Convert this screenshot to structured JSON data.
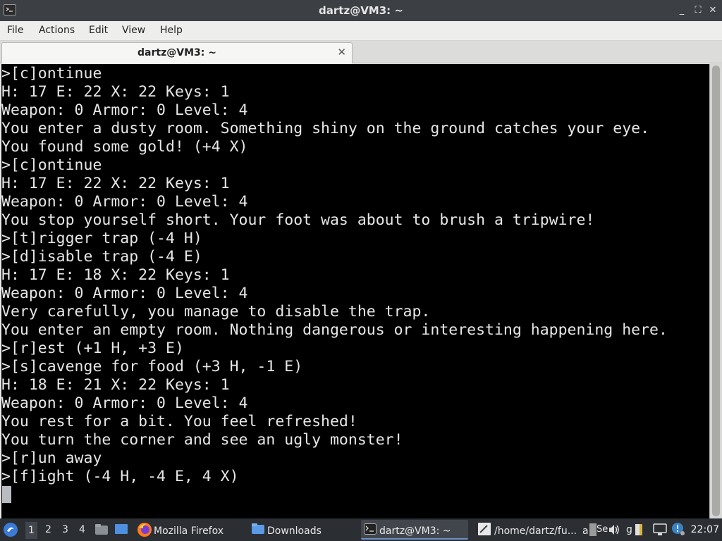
{
  "window": {
    "title": "dartz@VM3: ~",
    "controls": [
      "_",
      "⛶",
      "✕"
    ]
  },
  "menu": [
    "File",
    "Actions",
    "Edit",
    "View",
    "Help"
  ],
  "tab": {
    "label": "dartz@VM3: ~",
    "close": "✕"
  },
  "terminal": {
    "lines": [
      ">[c]ontinue",
      "H: 17 E: 22 X: 22 Keys: 1",
      "Weapon: 0 Armor: 0 Level: 4",
      "You enter a dusty room. Something shiny on the ground catches your eye.",
      "You found some gold! (+4 X)",
      ">[c]ontinue",
      "H: 17 E: 22 X: 22 Keys: 1",
      "Weapon: 0 Armor: 0 Level: 4",
      "You stop yourself short. Your foot was about to brush a tripwire!",
      ">[t]rigger trap (-4 H)",
      ">[d]isable trap (-4 E)",
      "H: 17 E: 18 X: 22 Keys: 1",
      "Weapon: 0 Armor: 0 Level: 4",
      "Very carefully, you manage to disable the trap.",
      "You enter an empty room. Nothing dangerous or interesting happening here.",
      ">[r]est (+1 H, +3 E)",
      ">[s]cavenge for food (+3 H, -1 E)",
      "H: 18 E: 21 X: 22 Keys: 1",
      "Weapon: 0 Armor: 0 Level: 4",
      "You rest for a bit. You feel refreshed!",
      "You turn the corner and see an ugly monster!",
      ">[r]un away",
      ">[f]ight (-4 H, -4 E, 4 X)"
    ]
  },
  "taskbar": {
    "workspaces": [
      "1",
      "2",
      "3",
      "4"
    ],
    "active_workspace": "1",
    "tasks": {
      "firefox": "Mozilla Firefox",
      "downloads": "Downloads",
      "terminal": "dartz@VM3: ~",
      "editor": "/home/dartz/fu...",
      "editor_extra": "a",
      "partial1": "Se",
      "partial2": "g"
    },
    "clock": "22:07"
  },
  "colors": {
    "titlebar": "#3c3f44",
    "terminal_bg": "#000000",
    "terminal_fg": "#e6e6e6",
    "taskbar": "#2b2e33",
    "accent": "#6a93c9"
  }
}
